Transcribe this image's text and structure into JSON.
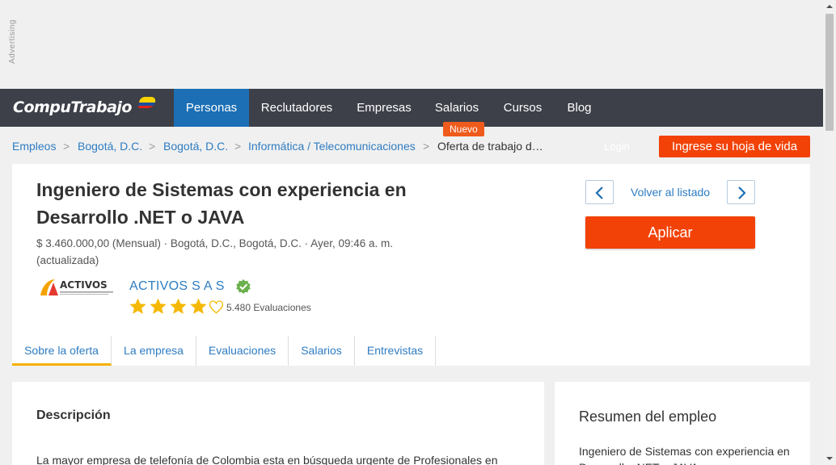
{
  "ad": {
    "label": "Advertising"
  },
  "nav": {
    "logo": "CompuTrabajo",
    "items": [
      {
        "label": "Personas",
        "active": true
      },
      {
        "label": "Reclutadores"
      },
      {
        "label": "Empresas"
      },
      {
        "label": "Salarios"
      },
      {
        "label": "Cursos"
      },
      {
        "label": "Blog"
      }
    ],
    "new_badge": "Nuevo"
  },
  "breadcrumb": {
    "items": [
      "Empleos",
      "Bogotá, D.C.",
      "Bogotá, D.C.",
      "Informática / Telecomunicaciones"
    ],
    "current": "Oferta de trabajo d…",
    "separator": ">"
  },
  "header_actions": {
    "login": "Login",
    "cv_button": "Ingrese su hoja de vida"
  },
  "job": {
    "title": "Ingeniero de Sistemas con experiencia en Desarrollo .NET o JAVA",
    "meta": "$ 3.460.000,00 (Mensual) ·  Bogotá, D.C., Bogotá, D.C. ·  Ayer, 09:46 a. m. (actualizada)",
    "company": {
      "logo_text": "ACTIVOS",
      "name": "ACTIVOS S A S",
      "rating": 4,
      "rating_max": 5,
      "reviews": "5.480 Evaluaciones"
    },
    "back_label": "Volver al listado",
    "apply_label": "Aplicar",
    "tabs": [
      "Sobre la oferta",
      "La empresa",
      "Evaluaciones",
      "Salarios",
      "Entrevistas"
    ]
  },
  "description": {
    "title": "Descripción",
    "text": "La mayor empresa de telefonía de Colombia esta en búsqueda urgente de Profesionales en"
  },
  "summary": {
    "title": "Resumen del empleo",
    "text": "Ingeniero de Sistemas con experiencia en Desarrollo .NET o JAVA"
  },
  "colors": {
    "nav_bg": "#3d4049",
    "nav_active": "#1c6fb5",
    "accent_orange": "#f24207",
    "link_blue": "#2e7cc2",
    "star_yellow": "#f5b800",
    "tab_underline": "#f5b100"
  }
}
